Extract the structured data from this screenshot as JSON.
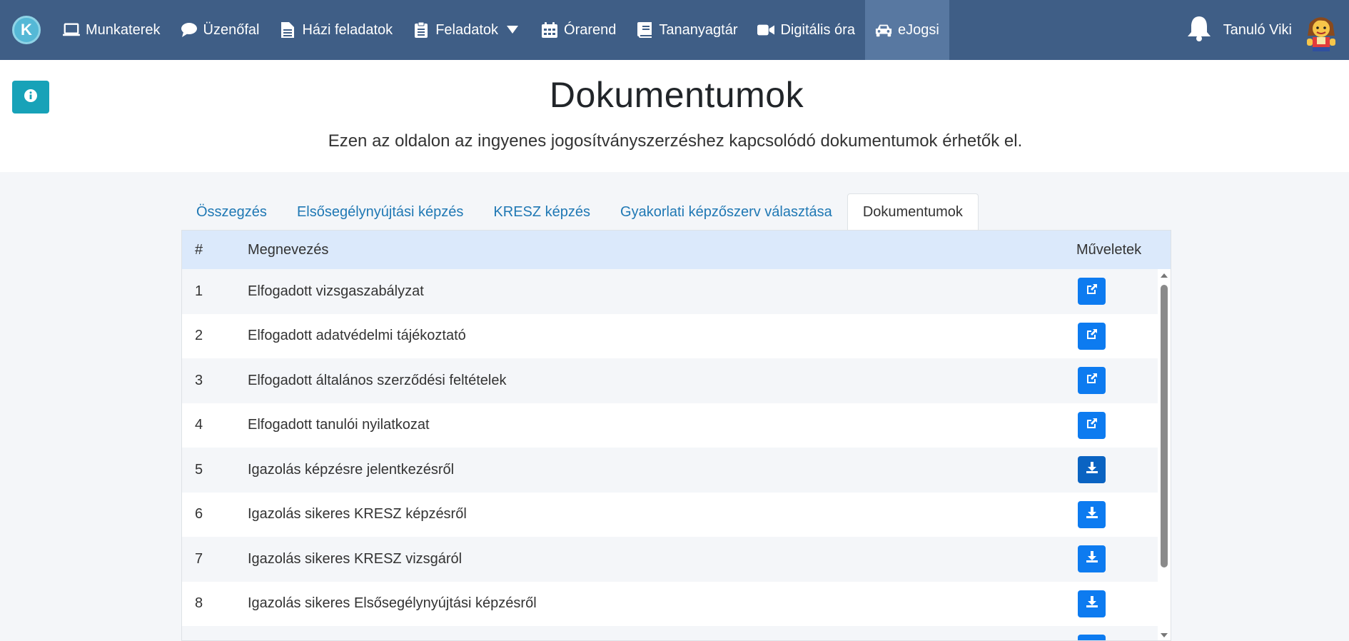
{
  "nav": {
    "brand_letter": "K",
    "items": [
      {
        "label": "Munkaterek",
        "icon": "laptop-icon"
      },
      {
        "label": "Üzenőfal",
        "icon": "comment-icon"
      },
      {
        "label": "Házi feladatok",
        "icon": "file-icon"
      },
      {
        "label": "Feladatok",
        "icon": "clipboard-icon"
      },
      {
        "label": "Órarend",
        "icon": "calendar-icon"
      },
      {
        "label": "Tananyagtár",
        "icon": "book-icon"
      },
      {
        "label": "Digitális óra",
        "icon": "video-icon"
      },
      {
        "label": "eJogsi",
        "icon": "car-icon"
      }
    ],
    "active_item": "eJogsi",
    "user_name": "Tanuló Viki"
  },
  "page": {
    "title": "Dokumentumok",
    "subtitle": "Ezen az oldalon az ingyenes jogosítványszerzéshez kapcsolódó dokumentumok érhetők el."
  },
  "tabs": [
    {
      "label": "Összegzés"
    },
    {
      "label": "Elsősegélynyújtási képzés"
    },
    {
      "label": "KRESZ képzés"
    },
    {
      "label": "Gyakorlati képzőszerv választása"
    },
    {
      "label": "Dokumentumok"
    }
  ],
  "active_tab": "Dokumentumok",
  "table": {
    "headers": {
      "num": "#",
      "name": "Megnevezés",
      "actions": "Műveletek"
    },
    "rows": [
      {
        "num": "1",
        "name": "Elfogadott vizsgaszabályzat",
        "action": "external-link-icon"
      },
      {
        "num": "2",
        "name": "Elfogadott adatvédelmi tájékoztató",
        "action": "external-link-icon"
      },
      {
        "num": "3",
        "name": "Elfogadott általános szerződési feltételek",
        "action": "external-link-icon"
      },
      {
        "num": "4",
        "name": "Elfogadott tanulói nyilatkozat",
        "action": "external-link-icon"
      },
      {
        "num": "5",
        "name": "Igazolás képzésre jelentkezésről",
        "action": "download-icon"
      },
      {
        "num": "6",
        "name": "Igazolás sikeres KRESZ képzésről",
        "action": "download-icon"
      },
      {
        "num": "7",
        "name": "Igazolás sikeres KRESZ vizsgáról",
        "action": "download-icon"
      },
      {
        "num": "8",
        "name": "Igazolás sikeres Elsősegélynyújtási képzésről",
        "action": "download-icon"
      },
      {
        "num": "",
        "name": "",
        "action": "download-icon"
      }
    ]
  },
  "colors": {
    "navbar": "#3f5e86",
    "navbar_active": "#5878a1",
    "info_button": "#17a2b8",
    "action_button": "#0d7bf0",
    "table_header": "#dbe9fb",
    "tab_link": "#1f78b4"
  }
}
